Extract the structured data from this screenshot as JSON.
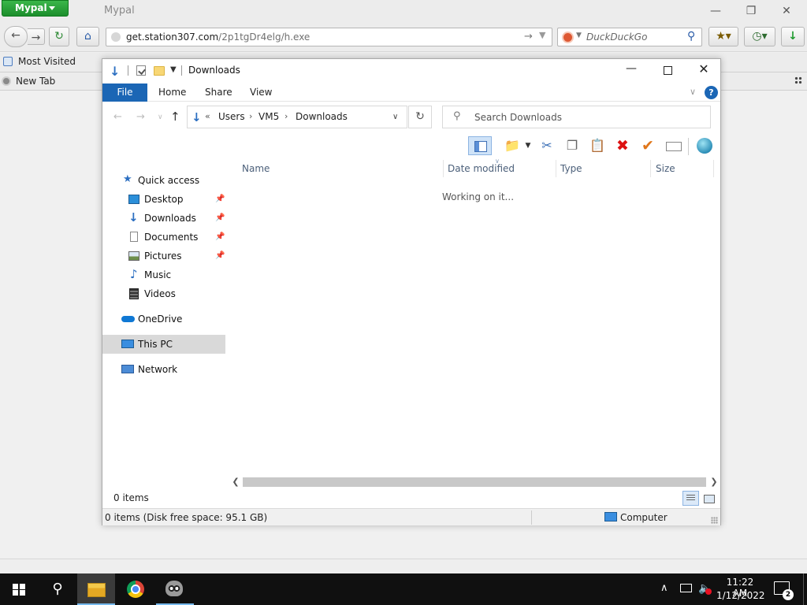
{
  "browser": {
    "menu_label": "Mypal",
    "title": "Mypal",
    "url_host": "get.station307.com",
    "url_path": "/2p1tgDr4elg/h.exe",
    "search_placeholder": "DuckDuckGo",
    "bookmarks": [
      "Most Visited"
    ],
    "tab_label": "New Tab"
  },
  "explorer": {
    "title": "Downloads",
    "ribbon_tabs": [
      "File",
      "Home",
      "Share",
      "View"
    ],
    "help": "?",
    "breadcrumb": [
      "Users",
      "VM5",
      "Downloads"
    ],
    "search_placeholder": "Search Downloads",
    "nav": {
      "quick_access": "Quick access",
      "desktop": "Desktop",
      "downloads": "Downloads",
      "documents": "Documents",
      "pictures": "Pictures",
      "music": "Music",
      "videos": "Videos",
      "onedrive": "OneDrive",
      "this_pc": "This PC",
      "network": "Network"
    },
    "columns": [
      "Name",
      "Date modified",
      "Type",
      "Size"
    ],
    "working_text": "Working on it...",
    "item_count": "0 items",
    "status_text": "0 items (Disk free space: 95.1 GB)",
    "status_location": "Computer"
  },
  "taskbar": {
    "time": "11:22 AM",
    "date": "1/12/2022",
    "notification_count": "2"
  }
}
